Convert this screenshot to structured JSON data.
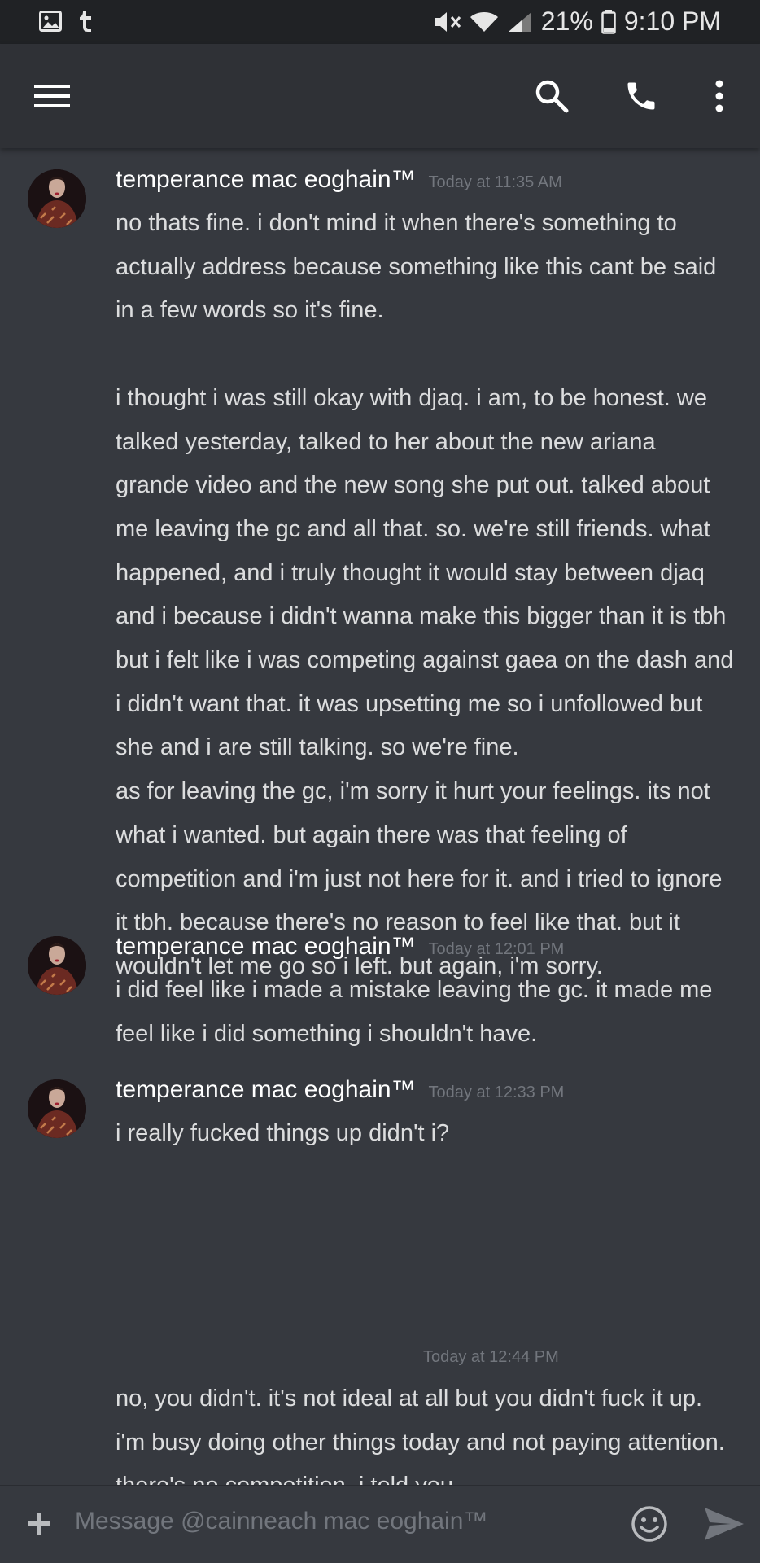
{
  "status_bar": {
    "battery": "21%",
    "time": "9:10 PM",
    "left_icons": [
      "image-icon",
      "tumblr-icon"
    ],
    "right_icons": [
      "mute-icon",
      "wifi-icon",
      "signal-icon",
      "battery-icon"
    ]
  },
  "app_bar": {
    "icons": [
      "menu-icon",
      "search-icon",
      "phone-icon",
      "more-vert-icon"
    ]
  },
  "messages": [
    {
      "author": "temperance mac eoghain™",
      "time": "Today at 11:35 AM",
      "text": "no thats fine. i don't mind it when there's something to actually address because something like this cant be said in a few words so it's fine.\n\ni thought i was still okay with djaq. i am, to be honest. we talked yesterday, talked to her about the new ariana grande video and the new song she put out. talked about me leaving the gc and all that. so. we're still friends. what happened, and i truly thought it would stay between djaq and i because i didn't wanna make this bigger than it is tbh but i felt like i was competing against gaea on the dash and i didn't want that. it was upsetting me so i unfollowed but she and i are still talking. so we're fine.\nas for leaving the gc, i'm sorry it hurt your feelings. its not what i wanted. but again there was that feeling of competition and i'm just not here for it. and i tried to ignore it tbh. because there's no reason to feel like that. but it wouldn't let me go so i left. but again, i'm sorry."
    },
    {
      "author": "temperance mac eoghain™",
      "time": "Today at 12:01 PM",
      "text": "i did feel like i made a mistake leaving the gc. it made me feel like i did something i shouldn't have."
    },
    {
      "author": "temperance mac eoghain™",
      "time": "Today at 12:33 PM",
      "text": "i really fucked things up didn't i?"
    }
  ],
  "continuation": {
    "time": "Today at 12:44 PM",
    "text": "no, you didn't. it's not ideal at all but you didn't fuck it up. i'm busy doing other things today and not paying attention. there's no competition. i told you"
  },
  "composer": {
    "placeholder": "Message @cainneach mac eoghain™",
    "icons": [
      "plus-icon",
      "emoji-icon",
      "send-icon"
    ]
  },
  "colors": {
    "background": "#36393f",
    "app_bar": "#2f3136",
    "status_bar": "#202225",
    "text": "#dcddde",
    "muted": "#72767d",
    "username": "#ffffff"
  }
}
